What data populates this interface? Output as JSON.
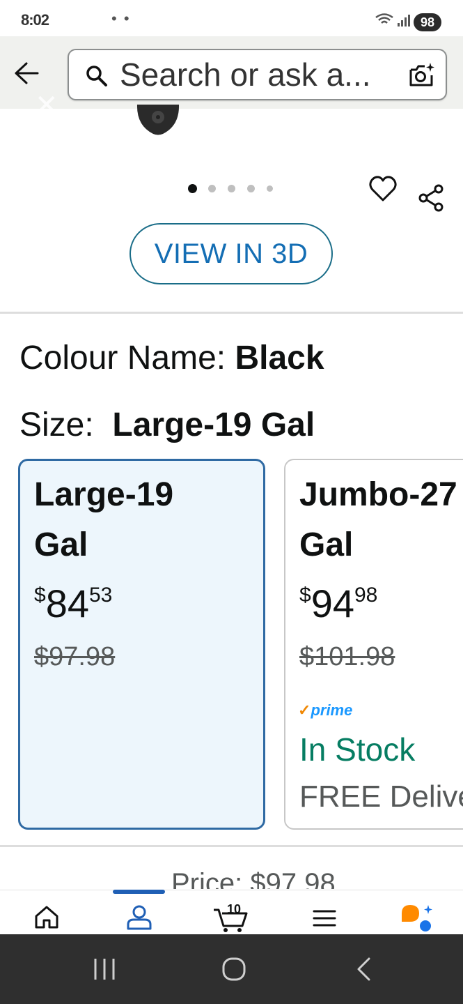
{
  "status_bar": {
    "time": "8:02",
    "notification_dots": "• •",
    "battery": "98"
  },
  "header": {
    "search_placeholder": "Search or ask a..."
  },
  "product_gallery": {
    "dot_count": 5,
    "active_dot": 0,
    "view_3d_label": "VIEW IN 3D"
  },
  "variations": {
    "colour_label": "Colour Name:",
    "colour_value": "Black",
    "size_label": "Size:",
    "size_value": "Large-19 Gal",
    "cards": [
      {
        "title_line1": "Large-19",
        "title_line2": "Gal",
        "price_symbol": "$",
        "price_whole": "84",
        "price_fraction": "53",
        "list_price": "$97.98",
        "selected": true
      },
      {
        "title_line1": "Jumbo-27",
        "title_line2": "Gal",
        "price_symbol": "$",
        "price_whole": "94",
        "price_fraction": "98",
        "list_price": "$101.98",
        "prime_label": "prime",
        "availability": "In Stock",
        "delivery": "FREE Delivery",
        "selected": false
      }
    ]
  },
  "price_teaser": "Price: $97.98",
  "bottom_nav": {
    "cart_count": "10",
    "items": [
      "home-icon",
      "account-icon",
      "cart-icon",
      "menu-icon",
      "rufus-icon"
    ]
  },
  "colors": {
    "link_blue": "#146eb4",
    "in_stock_green": "#067d62",
    "selected_border": "#2f6aa3",
    "selected_bg": "#edf6fc",
    "prime_blue": "#1a98ff"
  }
}
